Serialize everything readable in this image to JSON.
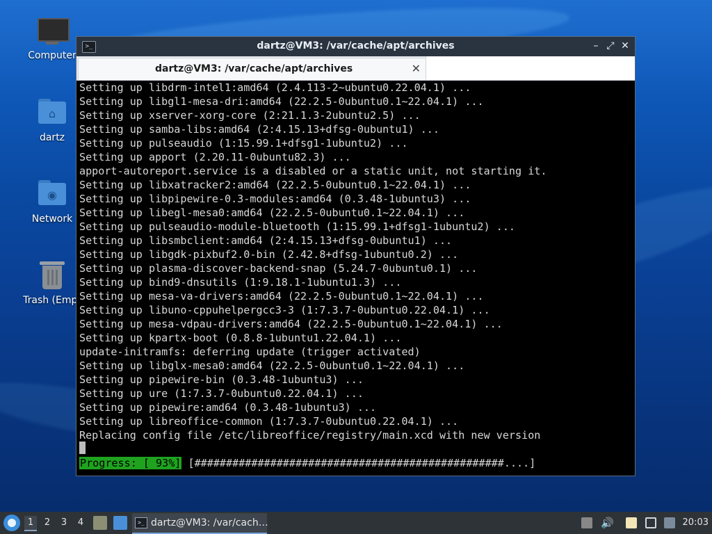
{
  "desktop": {
    "icons": [
      {
        "label": "Computer",
        "icon": "computer-icon"
      },
      {
        "label": "dartz",
        "icon": "home-folder-icon"
      },
      {
        "label": "Network",
        "icon": "network-folder-icon"
      },
      {
        "label": "Trash (Empt",
        "icon": "trash-icon"
      }
    ]
  },
  "window": {
    "title": "dartz@VM3: /var/cache/apt/archives",
    "controls": {
      "minimize": "–",
      "maximize": "⤢",
      "close": "✕"
    },
    "tab": {
      "label": "dartz@VM3: /var/cache/apt/archives",
      "close": "✕"
    },
    "terminal": {
      "lines": [
        "Setting up libdrm-intel1:amd64 (2.4.113-2~ubuntu0.22.04.1) ...",
        "Setting up libgl1-mesa-dri:amd64 (22.2.5-0ubuntu0.1~22.04.1) ...",
        "Setting up xserver-xorg-core (2:21.1.3-2ubuntu2.5) ...",
        "Setting up samba-libs:amd64 (2:4.15.13+dfsg-0ubuntu1) ...",
        "Setting up pulseaudio (1:15.99.1+dfsg1-1ubuntu2) ...",
        "Setting up apport (2.20.11-0ubuntu82.3) ...",
        "apport-autoreport.service is a disabled or a static unit, not starting it.",
        "Setting up libxatracker2:amd64 (22.2.5-0ubuntu0.1~22.04.1) ...",
        "Setting up libpipewire-0.3-modules:amd64 (0.3.48-1ubuntu3) ...",
        "Setting up libegl-mesa0:amd64 (22.2.5-0ubuntu0.1~22.04.1) ...",
        "Setting up pulseaudio-module-bluetooth (1:15.99.1+dfsg1-1ubuntu2) ...",
        "Setting up libsmbclient:amd64 (2:4.15.13+dfsg-0ubuntu1) ...",
        "Setting up libgdk-pixbuf2.0-bin (2.42.8+dfsg-1ubuntu0.2) ...",
        "Setting up plasma-discover-backend-snap (5.24.7-0ubuntu0.1) ...",
        "Setting up bind9-dnsutils (1:9.18.1-1ubuntu1.3) ...",
        "Setting up mesa-va-drivers:amd64 (22.2.5-0ubuntu0.1~22.04.1) ...",
        "Setting up libuno-cppuhelpergcc3-3 (1:7.3.7-0ubuntu0.22.04.1) ...",
        "Setting up mesa-vdpau-drivers:amd64 (22.2.5-0ubuntu0.1~22.04.1) ...",
        "Setting up kpartx-boot (0.8.8-1ubuntu1.22.04.1) ...",
        "update-initramfs: deferring update (trigger activated)",
        "Setting up libglx-mesa0:amd64 (22.2.5-0ubuntu0.1~22.04.1) ...",
        "Setting up pipewire-bin (0.3.48-1ubuntu3) ...",
        "Setting up ure (1:7.3.7-0ubuntu0.22.04.1) ...",
        "Setting up pipewire:amd64 (0.3.48-1ubuntu3) ...",
        "Setting up libreoffice-common (1:7.3.7-0ubuntu0.22.04.1) ...",
        "Replacing config file /etc/libreoffice/registry/main.xcd with new version"
      ],
      "progress_label": "Progress: [ 93%]",
      "progress_bar": "[#################################################....]",
      "progress_percent": 93
    }
  },
  "taskbar": {
    "workspaces": [
      "1",
      "2",
      "3",
      "4"
    ],
    "active_workspace": "1",
    "task_label": "dartz@VM3: /var/cach…",
    "clock": "20:03"
  }
}
